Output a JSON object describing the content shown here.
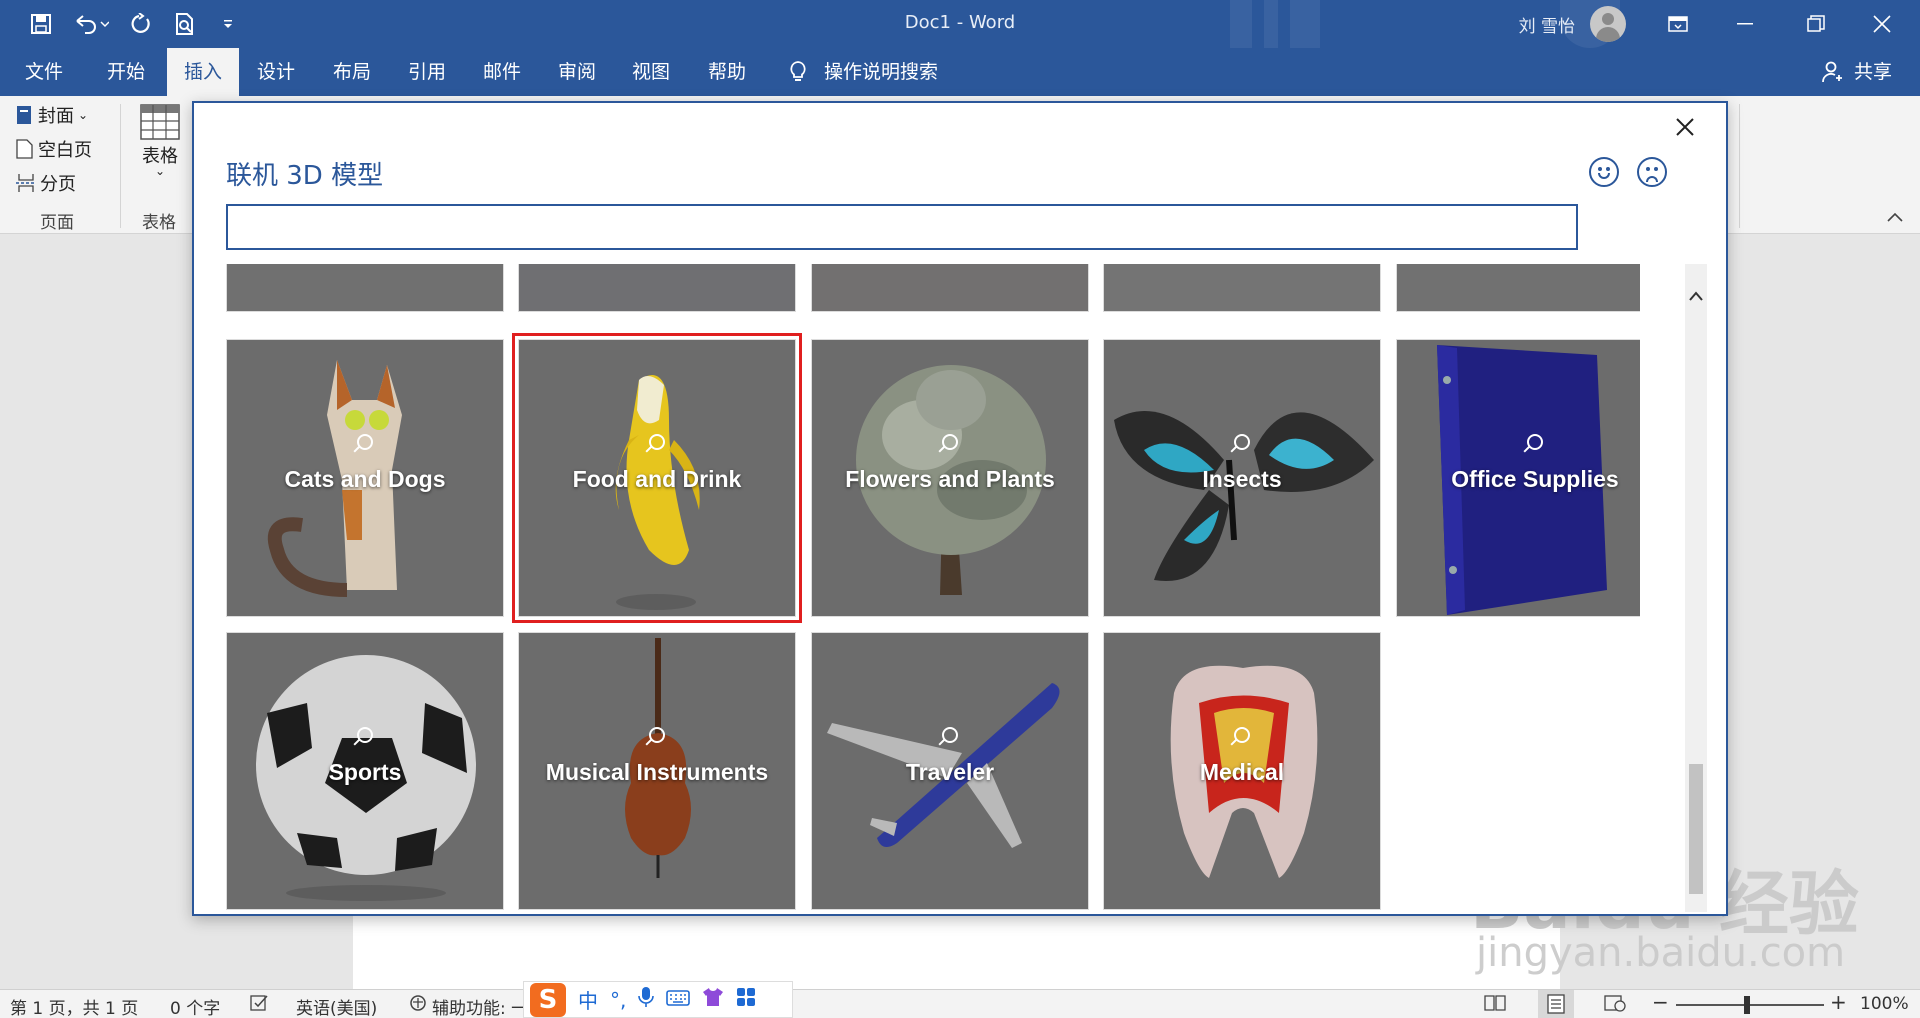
{
  "window": {
    "title": "Doc1  -  Word",
    "user_name": "刘 雪怡",
    "share_label": "共享"
  },
  "quick_access": {
    "save_icon": "save-icon",
    "undo_icon": "undo-icon",
    "redo_icon": "redo-icon",
    "preview_icon": "print-preview-icon",
    "customize_icon": "customize-icon"
  },
  "menu_tabs": [
    {
      "label": "文件"
    },
    {
      "label": "开始"
    },
    {
      "label": "插入",
      "active": true
    },
    {
      "label": "设计"
    },
    {
      "label": "布局"
    },
    {
      "label": "引用"
    },
    {
      "label": "邮件"
    },
    {
      "label": "审阅"
    },
    {
      "label": "视图"
    },
    {
      "label": "帮助"
    }
  ],
  "tell_me": "操作说明搜索",
  "ribbon": {
    "pages_group": {
      "cover": "封面",
      "blank": "空白页",
      "break": "分页",
      "label": "页面"
    },
    "table_group": {
      "table": "表格",
      "label": "表格"
    }
  },
  "dialog": {
    "title": "联机 3D 模型",
    "search_placeholder": "",
    "categories": [
      {
        "label": "Cats and Dogs"
      },
      {
        "label": "Food and Drink",
        "selected": true
      },
      {
        "label": "Flowers and Plants"
      },
      {
        "label": "Insects"
      },
      {
        "label": "Office Supplies"
      },
      {
        "label": "Sports"
      },
      {
        "label": "Musical Instruments"
      },
      {
        "label": "Traveler"
      },
      {
        "label": "Medical"
      }
    ]
  },
  "status": {
    "page": "第 1 页，共 1 页",
    "words": "0 个字",
    "language": "英语(美国)",
    "accessibility": "辅助功能: 一",
    "zoom": "100%",
    "minus": "−",
    "plus": "+"
  },
  "ime": {
    "logo": "S",
    "lang": "中",
    "punct": "°,"
  },
  "watermark": {
    "brand": "Baidu 经验",
    "url": "jingyan.baidu.com"
  },
  "colors": {
    "accent": "#2b579a",
    "selection": "#e01f1f"
  }
}
